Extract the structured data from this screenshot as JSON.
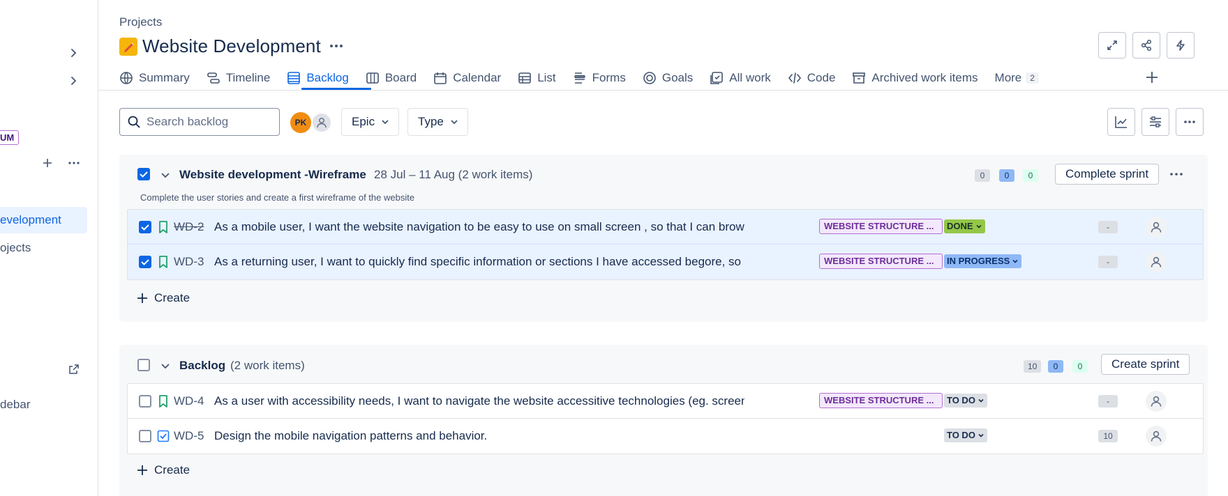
{
  "sidebar": {
    "badge": "UM",
    "active_item": "evelopment",
    "item_projects": "ojects",
    "item_sidebar": "debar"
  },
  "header": {
    "breadcrumb": "Projects",
    "title": "Website Development"
  },
  "tabs": [
    {
      "label": "Summary",
      "icon": "globe-icon"
    },
    {
      "label": "Timeline",
      "icon": "timeline-icon"
    },
    {
      "label": "Backlog",
      "icon": "backlog-icon",
      "active": true
    },
    {
      "label": "Board",
      "icon": "board-icon"
    },
    {
      "label": "Calendar",
      "icon": "calendar-icon"
    },
    {
      "label": "List",
      "icon": "list-icon"
    },
    {
      "label": "Forms",
      "icon": "forms-icon"
    },
    {
      "label": "Goals",
      "icon": "goals-icon"
    },
    {
      "label": "All work",
      "icon": "all-work-icon"
    },
    {
      "label": "Code",
      "icon": "code-icon"
    },
    {
      "label": "Archived work items",
      "icon": "archive-icon"
    },
    {
      "label": "More",
      "icon": "",
      "count": "2"
    }
  ],
  "toolbar": {
    "search_placeholder": "Search backlog",
    "avatar_initials": "PK",
    "filter_epic": "Epic",
    "filter_type": "Type"
  },
  "sprint": {
    "title": "Website development -Wireframe",
    "dates": "28 Jul – 11 Aug (2 work items)",
    "description": "Complete the user stories and create a first wireframe of the website",
    "counts": {
      "todo": "0",
      "in_progress": "0",
      "done": "0"
    },
    "action": "Complete sprint",
    "create": "Create",
    "items": [
      {
        "key": "WD-2",
        "summary": "As a mobile user, I want the website navigation to be easy to use on small screen , so that I can browse co...",
        "epic": "WEBSITE STRUCTURE ...",
        "status": "DONE",
        "estimate": "-"
      },
      {
        "key": "WD-3",
        "summary": "As a returning user, I want to quickly find specific information or sections I have accessed begore, so that I ...",
        "epic": "WEBSITE STRUCTURE ...",
        "status": "IN PROGRESS",
        "estimate": "-"
      }
    ]
  },
  "backlog": {
    "title": "Backlog",
    "meta": "(2 work items)",
    "counts": {
      "todo": "10",
      "in_progress": "0",
      "done": "0"
    },
    "action": "Create sprint",
    "create": "Create",
    "items": [
      {
        "key": "WD-4",
        "summary": "As a user with accessibility needs, I want to navigate the website accessitive technologies (eg. screen record...",
        "epic": "WEBSITE STRUCTURE ...",
        "status": "TO DO",
        "estimate": "-"
      },
      {
        "key": "WD-5",
        "summary": "Design the mobile navigation patterns and behavior.",
        "epic": "",
        "status": "TO DO",
        "estimate": "10"
      }
    ]
  },
  "colors": {
    "accent": "#0c66e4",
    "epic_bg": "#f3e8fc",
    "done": "#94c748",
    "in_progress": "#8fb8f6",
    "todo": "#dcdfe4"
  }
}
